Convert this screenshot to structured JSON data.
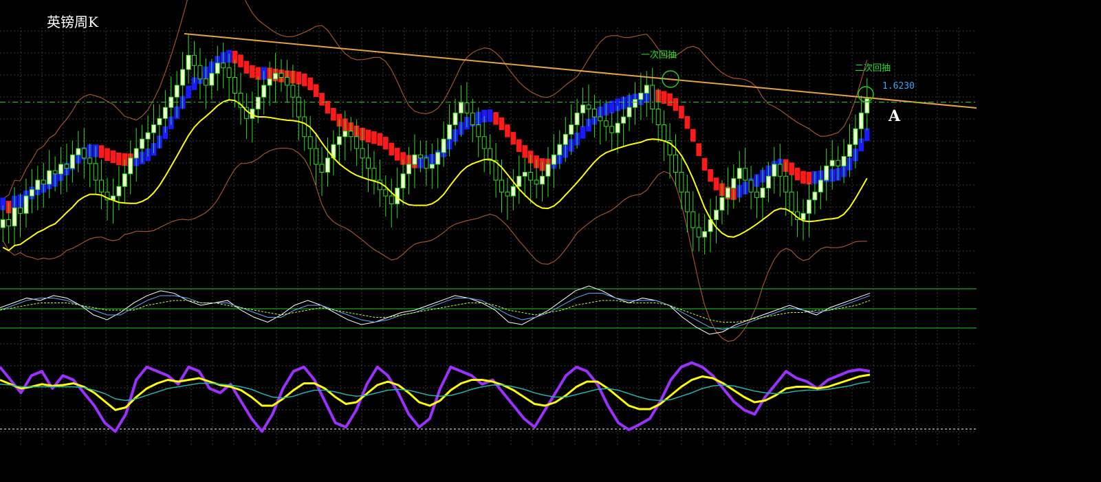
{
  "title": "英镑周K",
  "annotations": {
    "first_pullback": "一次回抽",
    "second_pullback": "二次回抽",
    "price_label": "1.6230",
    "marker": "A"
  },
  "colors": {
    "bull_candle": "#33dd22",
    "bull_candle_body": "#eeffcc",
    "bear_candle": "#33dd22",
    "trend_up": "#1a1aff",
    "trend_down": "#ff1a1a",
    "ma_line": "#ffff00",
    "bollinger": "#a0522d",
    "trendline": "#e6a23c",
    "grid": "#3a3a3a",
    "level_line": "#22cc22",
    "stoch_main": "#9b30ff",
    "stoch_signal": "#ffff00",
    "stoch_slow": "#20b2aa"
  },
  "chart_data": [
    {
      "type": "candlestick",
      "title": "英镑周K",
      "ylim": [
        1.4,
        1.7
      ],
      "level_value": 1.623,
      "series": [
        {
          "values": [
            1.47,
            1.462,
            1.485,
            1.478,
            1.5,
            1.508,
            1.52,
            1.515,
            1.532,
            1.528,
            1.54,
            1.535,
            1.552,
            1.56,
            1.548,
            1.541,
            1.52,
            1.505,
            1.495,
            1.5,
            1.512,
            1.528,
            1.548,
            1.56,
            1.572,
            1.58,
            1.59,
            1.598,
            1.612,
            1.625,
            1.64,
            1.66,
            1.678,
            1.665,
            1.648,
            1.64,
            1.655,
            1.668,
            1.662,
            1.65,
            1.63,
            1.612,
            1.598,
            1.61,
            1.625,
            1.64,
            1.648,
            1.655,
            1.65,
            1.64,
            1.625,
            1.6,
            1.575,
            1.56,
            1.54,
            1.53,
            1.548,
            1.565,
            1.575,
            1.582,
            1.575,
            1.56,
            1.548,
            1.535,
            1.52,
            1.508,
            1.5,
            1.49,
            1.51,
            1.528,
            1.54,
            1.552,
            1.548,
            1.535,
            1.54,
            1.555,
            1.572,
            1.59,
            1.605,
            1.618,
            1.605,
            1.59,
            1.575,
            1.56,
            1.545,
            1.52,
            1.505,
            1.5,
            1.512,
            1.525,
            1.53,
            1.52,
            1.515,
            1.525,
            1.54,
            1.552,
            1.565,
            1.578,
            1.59,
            1.605,
            1.615,
            1.61,
            1.6,
            1.595,
            1.588,
            1.58,
            1.592,
            1.6,
            1.612,
            1.622,
            1.63,
            1.64,
            1.61,
            1.59,
            1.57,
            1.552,
            1.53,
            1.505,
            1.48,
            1.46,
            1.448,
            1.455,
            1.47,
            1.482,
            1.498,
            1.51,
            1.522,
            1.535,
            1.52,
            1.505,
            1.498,
            1.51,
            1.525,
            1.54,
            1.525,
            1.505,
            1.48,
            1.47,
            1.478,
            1.495,
            1.505,
            1.52,
            1.538,
            1.545,
            1.538,
            1.55,
            1.565,
            1.585,
            1.605,
            1.623
          ]
        }
      ]
    },
    {
      "type": "line",
      "ylim": [
        -1,
        1
      ],
      "series": [
        {
          "values": [
            0.1,
            0.3,
            0.5,
            0.4,
            0.6,
            0.5,
            0.2,
            -0.2,
            -0.4,
            -0.1,
            0.3,
            0.6,
            0.8,
            0.7,
            0.4,
            0.2,
            0.3,
            0.4,
            0.0,
            -0.3,
            -0.5,
            -0.2,
            0.2,
            0.4,
            0.2,
            -0.1,
            -0.4,
            -0.6,
            -0.5,
            -0.3,
            -0.1,
            0.0,
            0.2,
            0.4,
            0.6,
            0.5,
            0.3,
            0.0,
            -0.5,
            -0.6,
            -0.3,
            0.0,
            0.4,
            0.8,
            1.0,
            0.8,
            0.5,
            0.3,
            0.5,
            0.4,
            0.2,
            -0.3,
            -0.7,
            -1.0,
            -0.9,
            -0.6,
            -0.4,
            -0.2,
            0.0,
            0.2,
            0.0,
            -0.2,
            0.1,
            0.3,
            0.5,
            0.7
          ]
        },
        {
          "values": [
            0.0,
            0.2,
            0.4,
            0.5,
            0.5,
            0.4,
            0.2,
            0.0,
            -0.2,
            -0.2,
            0.1,
            0.4,
            0.6,
            0.6,
            0.5,
            0.3,
            0.3,
            0.3,
            0.1,
            -0.1,
            -0.3,
            -0.3,
            0.0,
            0.2,
            0.2,
            0.0,
            -0.2,
            -0.4,
            -0.5,
            -0.4,
            -0.2,
            -0.1,
            0.1,
            0.3,
            0.5,
            0.5,
            0.4,
            0.1,
            -0.2,
            -0.4,
            -0.3,
            -0.1,
            0.2,
            0.5,
            0.7,
            0.7,
            0.5,
            0.4,
            0.4,
            0.4,
            0.2,
            -0.1,
            -0.4,
            -0.7,
            -0.8,
            -0.7,
            -0.5,
            -0.3,
            -0.1,
            0.1,
            0.0,
            -0.1,
            0.0,
            0.2,
            0.4,
            0.6
          ]
        },
        {
          "values": [
            0.0,
            0.1,
            0.2,
            0.3,
            0.3,
            0.3,
            0.2,
            0.1,
            0.0,
            0.0,
            0.0,
            0.2,
            0.3,
            0.4,
            0.4,
            0.3,
            0.3,
            0.2,
            0.1,
            0.0,
            -0.1,
            -0.2,
            -0.1,
            0.0,
            0.1,
            0.0,
            -0.1,
            -0.2,
            -0.3,
            -0.3,
            -0.2,
            -0.1,
            0.0,
            0.1,
            0.2,
            0.3,
            0.3,
            0.2,
            0.0,
            -0.1,
            -0.2,
            -0.1,
            0.0,
            0.2,
            0.3,
            0.4,
            0.4,
            0.3,
            0.3,
            0.3,
            0.2,
            0.0,
            -0.2,
            -0.4,
            -0.5,
            -0.5,
            -0.4,
            -0.3,
            -0.2,
            -0.1,
            -0.1,
            0.0,
            0.0,
            0.1,
            0.2,
            0.4
          ]
        }
      ]
    },
    {
      "type": "line",
      "ylim": [
        0,
        100
      ],
      "series": [
        {
          "values": [
            85,
            70,
            55,
            75,
            80,
            60,
            75,
            70,
            55,
            40,
            20,
            10,
            30,
            70,
            85,
            80,
            75,
            65,
            85,
            80,
            60,
            55,
            65,
            45,
            25,
            10,
            30,
            60,
            80,
            85,
            70,
            45,
            20,
            15,
            35,
            65,
            85,
            75,
            55,
            30,
            15,
            25,
            60,
            85,
            80,
            75,
            65,
            70,
            55,
            40,
            25,
            15,
            35,
            55,
            75,
            85,
            80,
            65,
            40,
            20,
            12,
            18,
            25,
            45,
            70,
            85,
            90,
            85,
            75,
            60,
            45,
            35,
            30,
            50,
            65,
            80,
            72,
            68,
            60,
            70,
            75,
            80,
            82,
            80
          ]
        },
        {
          "values": [
            70,
            65,
            60,
            62,
            65,
            63,
            64,
            66,
            62,
            55,
            45,
            35,
            38,
            50,
            60,
            66,
            70,
            68,
            70,
            72,
            68,
            64,
            62,
            58,
            50,
            40,
            40,
            48,
            58,
            66,
            66,
            60,
            50,
            42,
            44,
            54,
            64,
            68,
            64,
            55,
            44,
            40,
            46,
            58,
            66,
            70,
            70,
            68,
            64,
            58,
            50,
            42,
            40,
            44,
            52,
            62,
            68,
            68,
            60,
            50,
            40,
            36,
            36,
            42,
            52,
            62,
            70,
            74,
            72,
            66,
            58,
            50,
            44,
            46,
            52,
            60,
            62,
            62,
            60,
            62,
            66,
            70,
            74,
            76
          ]
        },
        {
          "values": [
            65,
            64,
            62,
            62,
            62,
            62,
            62,
            62,
            61,
            58,
            54,
            48,
            46,
            48,
            52,
            56,
            60,
            62,
            64,
            66,
            66,
            65,
            64,
            62,
            59,
            54,
            50,
            49,
            51,
            55,
            58,
            58,
            56,
            53,
            51,
            52,
            55,
            58,
            59,
            58,
            55,
            52,
            51,
            52,
            55,
            59,
            62,
            64,
            64,
            62,
            59,
            55,
            52,
            50,
            50,
            53,
            56,
            59,
            60,
            58,
            54,
            50,
            47,
            46,
            47,
            51,
            55,
            60,
            63,
            64,
            63,
            60,
            57,
            55,
            54,
            55,
            57,
            58,
            58,
            59,
            61,
            63,
            66,
            68
          ]
        }
      ]
    }
  ]
}
